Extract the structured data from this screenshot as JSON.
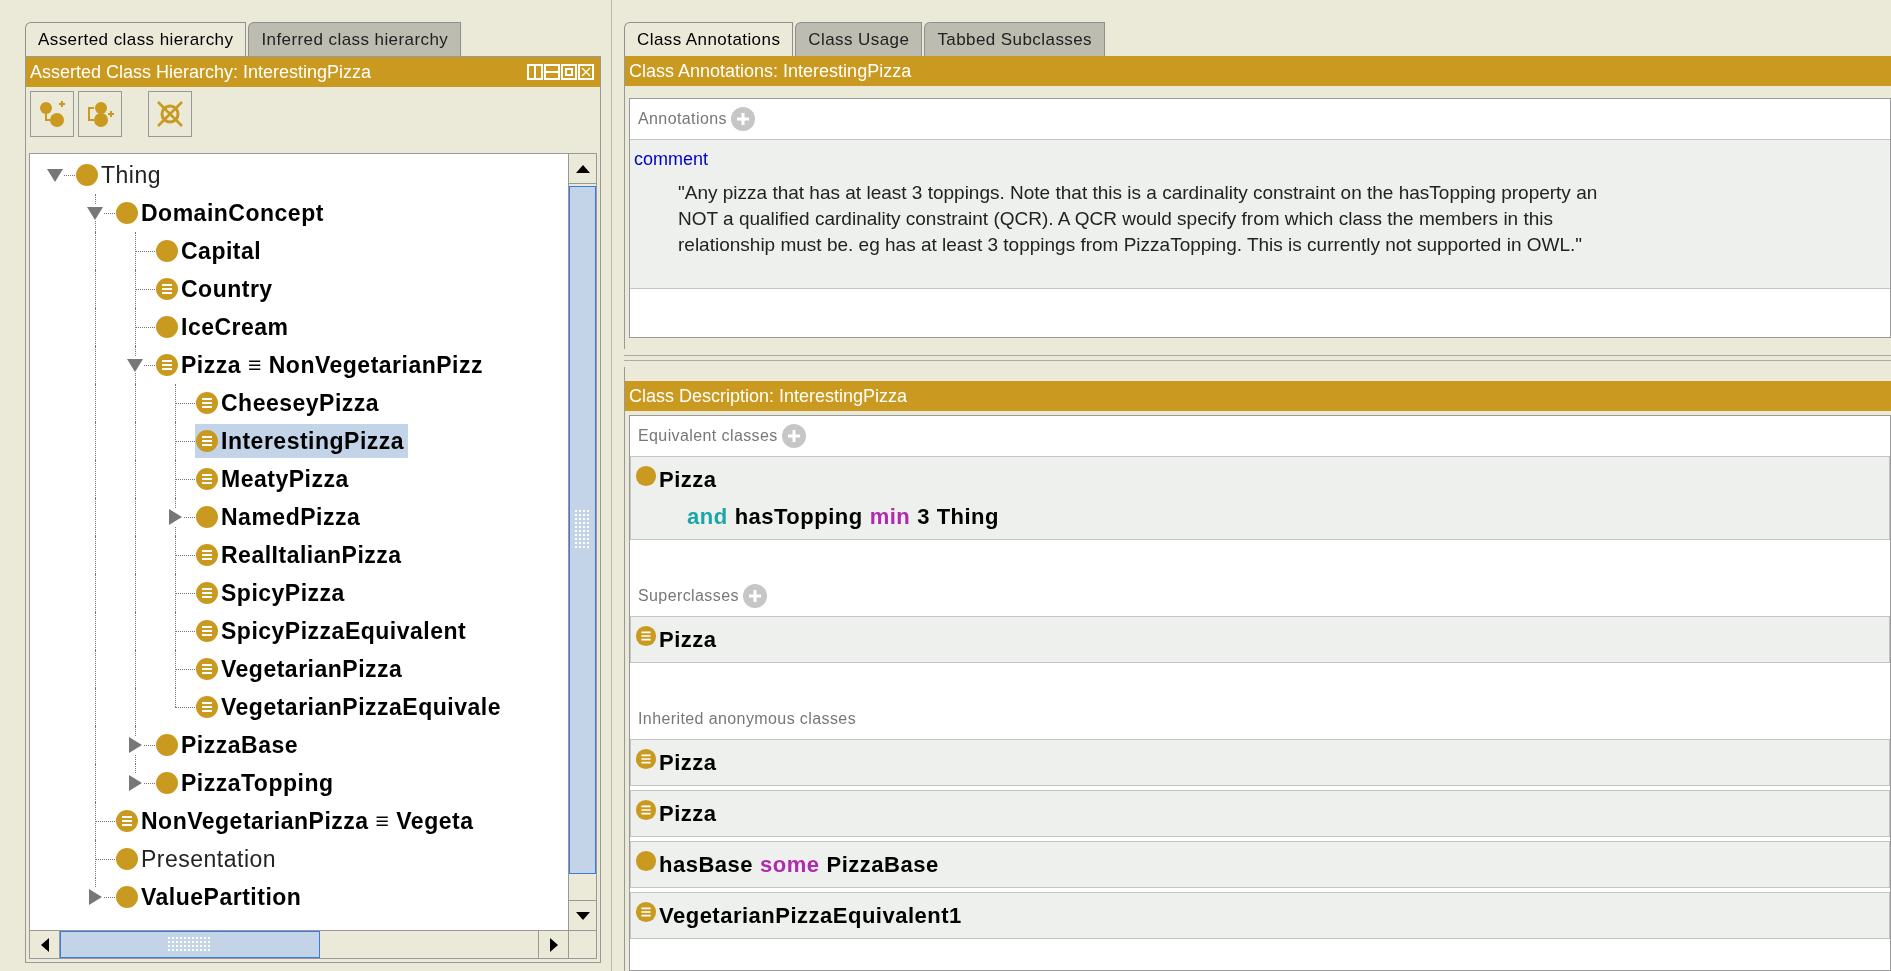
{
  "left_panel": {
    "tabs": [
      {
        "label": "Asserted class hierarchy",
        "selected": true
      },
      {
        "label": "Inferred class hierarchy",
        "selected": false
      }
    ],
    "view_title": "Asserted Class Hierarchy: InterestingPizza",
    "tree": [
      {
        "label": "Thing",
        "kind": "primitive",
        "bold": false,
        "expanded": true,
        "selected": false,
        "children": [
          {
            "label": "DomainConcept",
            "kind": "primitive",
            "bold": true,
            "expanded": true,
            "selected": false,
            "children": [
              {
                "label": "Capital",
                "kind": "primitive",
                "bold": true,
                "selected": false
              },
              {
                "label": "Country",
                "kind": "defined",
                "bold": true,
                "selected": false
              },
              {
                "label": "IceCream",
                "kind": "primitive",
                "bold": true,
                "selected": false
              },
              {
                "label": "Pizza ≡ NonVegetarianPizz",
                "kind": "defined",
                "bold": true,
                "expanded": true,
                "selected": false,
                "children": [
                  {
                    "label": "CheeseyPizza",
                    "kind": "defined",
                    "bold": true,
                    "selected": false
                  },
                  {
                    "label": "InterestingPizza",
                    "kind": "defined",
                    "bold": true,
                    "selected": true
                  },
                  {
                    "label": "MeatyPizza",
                    "kind": "defined",
                    "bold": true,
                    "selected": false
                  },
                  {
                    "label": "NamedPizza",
                    "kind": "primitive",
                    "bold": true,
                    "expanded": false,
                    "selected": false
                  },
                  {
                    "label": "RealItalianPizza",
                    "kind": "defined",
                    "bold": true,
                    "selected": false
                  },
                  {
                    "label": "SpicyPizza",
                    "kind": "defined",
                    "bold": true,
                    "selected": false
                  },
                  {
                    "label": "SpicyPizzaEquivalent",
                    "kind": "defined",
                    "bold": true,
                    "selected": false
                  },
                  {
                    "label": "VegetarianPizza",
                    "kind": "defined",
                    "bold": true,
                    "selected": false
                  },
                  {
                    "label": "VegetarianPizzaEquivale",
                    "kind": "defined",
                    "bold": true,
                    "selected": false
                  }
                ]
              },
              {
                "label": "PizzaBase",
                "kind": "primitive",
                "bold": true,
                "expanded": false,
                "selected": false
              },
              {
                "label": "PizzaTopping",
                "kind": "primitive",
                "bold": true,
                "expanded": false,
                "selected": false
              }
            ]
          },
          {
            "label": "NonVegetarianPizza ≡ Vegeta",
            "kind": "defined",
            "bold": true,
            "selected": false
          },
          {
            "label": "Presentation",
            "kind": "primitive",
            "bold": false,
            "selected": false
          },
          {
            "label": "ValuePartition",
            "kind": "primitive",
            "bold": true,
            "expanded": false,
            "selected": false
          }
        ]
      }
    ]
  },
  "right_panel": {
    "tabs": [
      {
        "label": "Class Annotations",
        "selected": true
      },
      {
        "label": "Class Usage",
        "selected": false
      },
      {
        "label": "Tabbed Subclasses",
        "selected": false
      }
    ],
    "annotations_view": {
      "title": "Class Annotations: InterestingPizza",
      "section": "Annotations",
      "property": "comment",
      "comment_lines": [
        "\"Any pizza that has at least 3 toppings. Note that this is a cardinality constraint on the hasTopping property an",
        "NOT a qualified cardinality constraint (QCR). A QCR would specify from which class the members in this",
        "relationship must be. eg has at least 3 toppings from PizzaTopping. This is currently not supported in OWL.\""
      ]
    },
    "description_view": {
      "title": "Class Description: InterestingPizza",
      "sections": [
        {
          "heading": "Equivalent classes",
          "addable": true,
          "items": [
            {
              "kind": "primitive",
              "lines": [
                [
                  {
                    "text": "Pizza",
                    "kind": "name"
                  }
                ],
                [
                  {
                    "text": "and",
                    "kind": "connective"
                  },
                  {
                    "text": "hasTopping",
                    "kind": "name"
                  },
                  {
                    "text": "min",
                    "kind": "restriction"
                  },
                  {
                    "text": "3 Thing",
                    "kind": "name"
                  }
                ]
              ]
            }
          ]
        },
        {
          "heading": "Superclasses",
          "addable": true,
          "items": [
            {
              "kind": "defined",
              "lines": [
                [
                  {
                    "text": "Pizza",
                    "kind": "name"
                  }
                ]
              ]
            }
          ]
        },
        {
          "heading": "Inherited anonymous classes",
          "addable": false,
          "items": [
            {
              "kind": "defined",
              "lines": [
                [
                  {
                    "text": "Pizza",
                    "kind": "name"
                  }
                ]
              ]
            },
            {
              "kind": "defined",
              "lines": [
                [
                  {
                    "text": "Pizza",
                    "kind": "name"
                  }
                ]
              ]
            },
            {
              "kind": "primitive",
              "lines": [
                [
                  {
                    "text": "hasBase",
                    "kind": "name"
                  },
                  {
                    "text": "some",
                    "kind": "restriction"
                  },
                  {
                    "text": "PizzaBase",
                    "kind": "name"
                  }
                ]
              ]
            },
            {
              "kind": "defined",
              "lines": [
                [
                  {
                    "text": "VegetarianPizzaEquivalent1",
                    "kind": "name"
                  }
                ]
              ]
            }
          ]
        }
      ]
    }
  }
}
